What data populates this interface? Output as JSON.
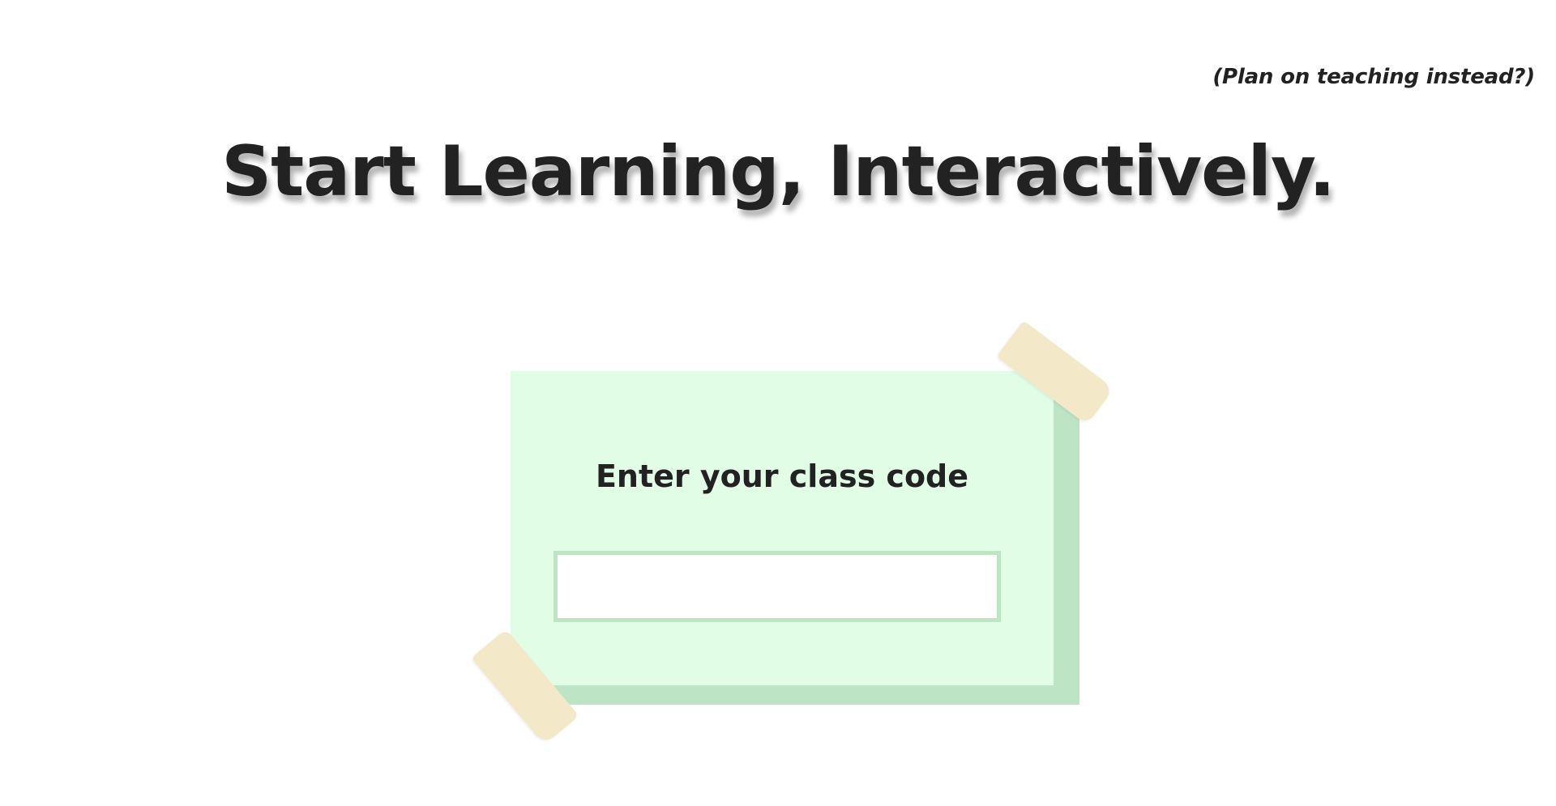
{
  "header": {
    "teacher_link": "(Plan on teaching instead?)",
    "headline": "Start Learning, Interactively."
  },
  "join_card": {
    "title": "Enter your class code",
    "input_value": "",
    "input_placeholder": "",
    "colors": {
      "card_background": "#e2fde6",
      "card_shadow": "#bde4c4",
      "tape": "#f3e8c8"
    }
  }
}
